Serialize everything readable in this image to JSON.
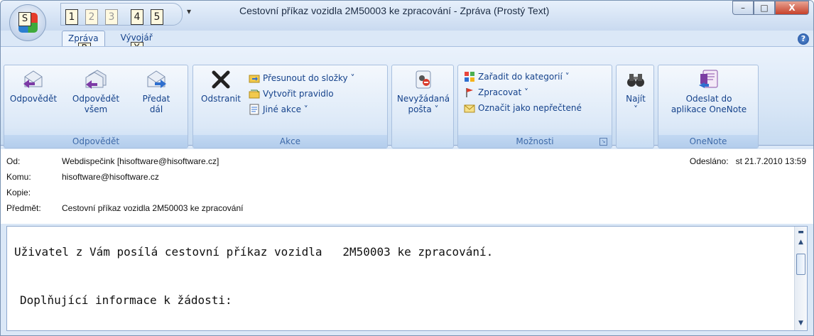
{
  "window": {
    "title": "Cestovní příkaz vozidla 2M50003 ke zpracování - Zpráva (Prostý Text)",
    "office_key": "S",
    "qat_keys": [
      "1",
      "2",
      "3",
      "4",
      "5"
    ],
    "minimize": "–",
    "maximize": "□",
    "close": "X"
  },
  "tabs": [
    {
      "label": "Zpráva",
      "key": "R"
    },
    {
      "label": "Vývojář",
      "key": "Y"
    }
  ],
  "help": "?",
  "ribbon": {
    "odpovedet": {
      "label": "Odpovědět",
      "reply": "Odpovědět",
      "reply_all_1": "Odpovědět",
      "reply_all_2": "všem",
      "forward_1": "Předat",
      "forward_2": "dál"
    },
    "akce": {
      "label": "Akce",
      "delete": "Odstranit",
      "move": "Přesunout do složky ˅",
      "rule": "Vytvořit pravidlo",
      "other": "Jiné akce ˅"
    },
    "junk": {
      "line1": "Nevyžádaná",
      "line2": "pošta ˅"
    },
    "moznosti": {
      "label": "Možnosti",
      "categorize": "Zařadit do kategorií ˅",
      "followup": "Zpracovat ˅",
      "mark_unread": "Označit jako nepřečtené"
    },
    "find": {
      "label": "Najít",
      "arrow": "˅"
    },
    "onenote": {
      "label": "OneNote",
      "line1": "Odeslat do",
      "line2": "aplikace OneNote"
    }
  },
  "headers": {
    "from_label": "Od:",
    "from_value": "Webdispečink [hisoftware@hisoftware.cz]",
    "to_label": "Komu:",
    "to_value": "hisoftware@hisoftware.cz",
    "cc_label": "Kopie:",
    "cc_value": "",
    "subject_label": "Předmět:",
    "subject_value": "Cestovní příkaz vozidla 2M50003 ke zpracování",
    "sent_label": "Odesláno:",
    "sent_value": "st 21.7.2010 13:59"
  },
  "body": {
    "line1": "Uživatel z Vám posílá cestovní příkaz vozidla   2M50003 ke zpracování.",
    "line2": "Doplňující informace k žádosti:"
  }
}
